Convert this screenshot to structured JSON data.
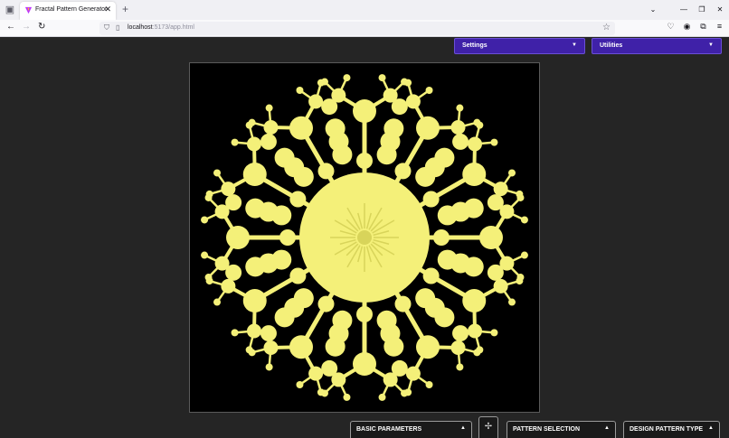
{
  "browser": {
    "tab_title": "Fractal Pattern Generator",
    "tab_close": "✕",
    "new_tab": "+",
    "url_host": "localhost",
    "url_rest": ":5173/app.html",
    "window_controls": {
      "list": "⌄",
      "minimize": "—",
      "restore": "❐",
      "close": "✕"
    }
  },
  "top_menus": [
    {
      "label": "Settings",
      "arrow": "▼"
    },
    {
      "label": "Utilities",
      "arrow": "▼"
    }
  ],
  "bottom_panels": [
    {
      "label": "BASIC PARAMETERS",
      "arrow": "▲"
    },
    {
      "label": "PATTERN SELECTION",
      "arrow": "▲"
    },
    {
      "label": "DESIGN PATTERN TYPE",
      "arrow": "▲"
    }
  ],
  "move_handle": "✢",
  "colors": {
    "fractal_fill": "#f4f079",
    "fractal_shade": "#d8d45a",
    "menu_bg": "#3f21a8",
    "canvas_bg": "#000000",
    "app_bg": "#252525"
  },
  "fractal": {
    "symmetry": 12,
    "icons": [
      "sidebar-icon",
      "back-icon",
      "forward-icon",
      "reload-icon",
      "shield-icon",
      "page-icon",
      "star-icon",
      "pocket-icon",
      "account-icon",
      "extensions-icon",
      "menu-icon"
    ]
  }
}
